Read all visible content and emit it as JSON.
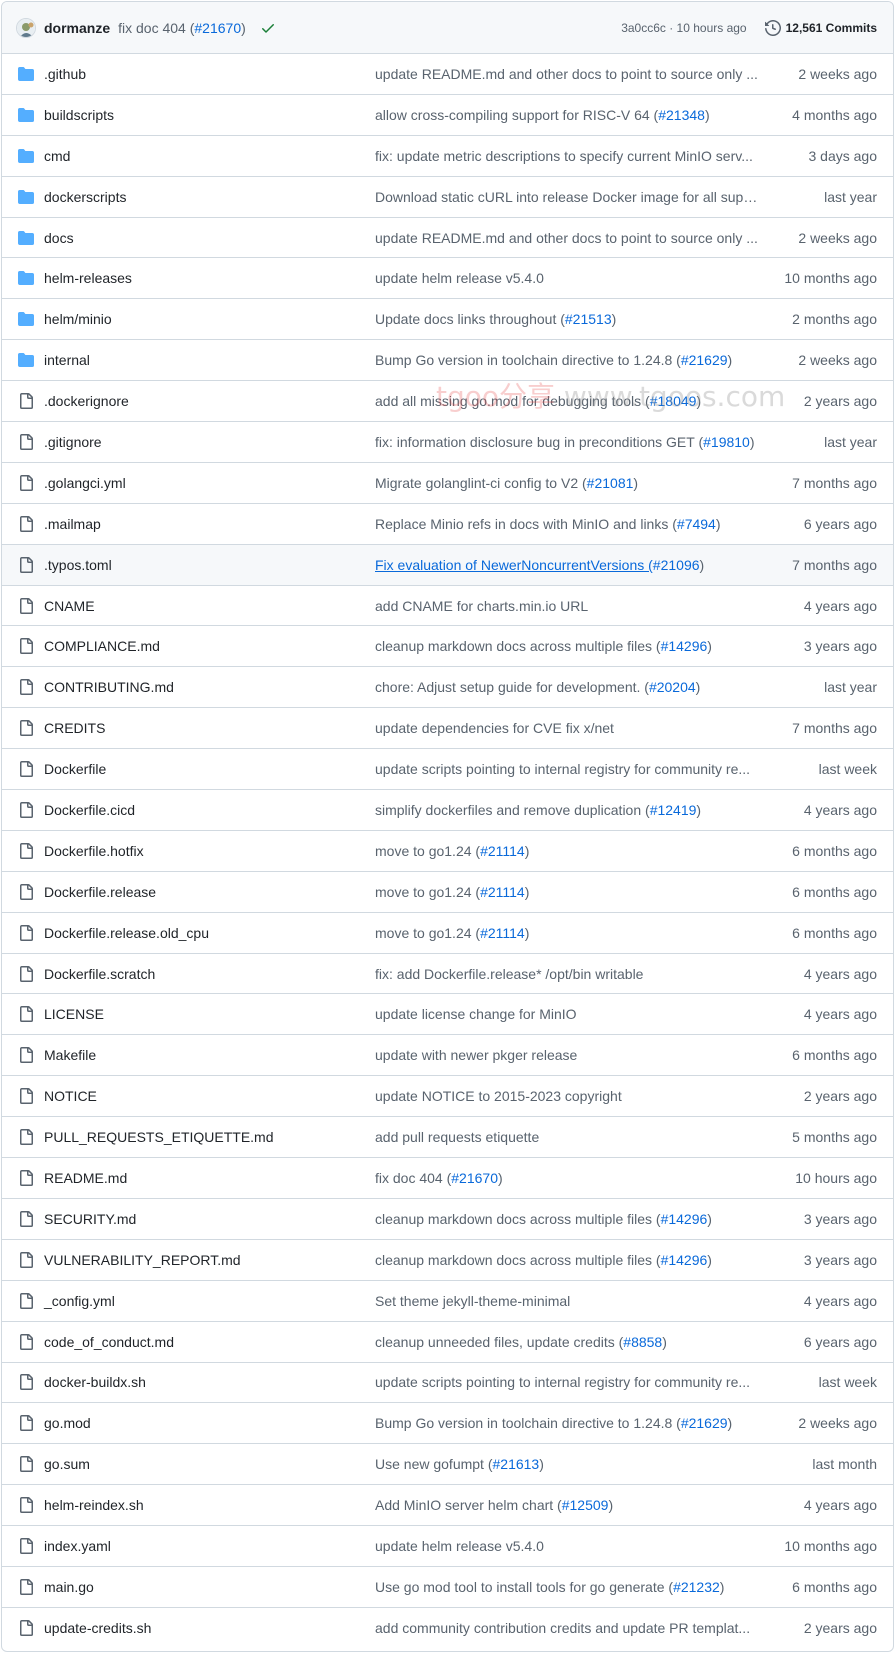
{
  "colors": {
    "folder": "#54aeff",
    "file": "#59636e",
    "link": "#0969da",
    "success": "#1a7f37",
    "border": "#d1d9e0",
    "header_bg": "#f6f8fa"
  },
  "commit": {
    "author": "dormanze",
    "message_prefix": "fix doc 404 (",
    "pr": "#21670",
    "message_suffix": ")",
    "status_icon": "check-icon",
    "sha_time": "3a0cc6c · 10 hours ago",
    "commits_count": "12,561 Commits",
    "commits_icon": "history-icon"
  },
  "watermark": {
    "brand": "tgoo分享",
    "url": "www.tgoos.com"
  },
  "files": [
    {
      "type": "dir",
      "name": ".github",
      "msg": "update README.md and other docs to point to source only ...",
      "pr": "",
      "after": "",
      "date": "2 weeks ago"
    },
    {
      "type": "dir",
      "name": "buildscripts",
      "msg": "allow cross-compiling support for RISC-V 64 (",
      "pr": "#21348",
      "after": ")",
      "date": "4 months ago"
    },
    {
      "type": "dir",
      "name": "cmd",
      "msg": "fix: update metric descriptions to specify current MinIO serv...",
      "pr": "",
      "after": "",
      "date": "3 days ago"
    },
    {
      "type": "dir",
      "name": "dockerscripts",
      "msg": "Download static cURL into release Docker image for all supp...",
      "pr": "",
      "after": "",
      "date": "last year"
    },
    {
      "type": "dir",
      "name": "docs",
      "msg": "update README.md and other docs to point to source only ...",
      "pr": "",
      "after": "",
      "date": "2 weeks ago"
    },
    {
      "type": "dir",
      "name": "helm-releases",
      "msg": "update helm release v5.4.0",
      "pr": "",
      "after": "",
      "date": "10 months ago"
    },
    {
      "type": "dir",
      "name": "helm/minio",
      "msg": "Update docs links throughout (",
      "pr": "#21513",
      "after": ")",
      "date": "2 months ago"
    },
    {
      "type": "dir",
      "name": "internal",
      "msg": "Bump Go version in toolchain directive to 1.24.8 (",
      "pr": "#21629",
      "after": ")",
      "date": "2 weeks ago"
    },
    {
      "type": "file",
      "name": ".dockerignore",
      "msg": "add all missing go.mod for debugging tools (",
      "pr": "#18049",
      "after": ")",
      "date": "2 years ago"
    },
    {
      "type": "file",
      "name": ".gitignore",
      "msg": "fix: information disclosure bug in preconditions GET (",
      "pr": "#19810",
      "after": ")",
      "date": "last year"
    },
    {
      "type": "file",
      "name": ".golangci.yml",
      "msg": "Migrate golanglint-ci config to V2 (",
      "pr": "#21081",
      "after": ")",
      "date": "7 months ago"
    },
    {
      "type": "file",
      "name": ".mailmap",
      "msg": "Replace Minio refs in docs with MinIO and links (",
      "pr": "#7494",
      "after": ")",
      "date": "6 years ago"
    },
    {
      "type": "file",
      "name": ".typos.toml",
      "msg": "Fix evaluation of NewerNoncurrentVersions (",
      "pr": "#21096",
      "after": ")",
      "date": "7 months ago",
      "hovered": true
    },
    {
      "type": "file",
      "name": "CNAME",
      "msg": "add CNAME for charts.min.io URL",
      "pr": "",
      "after": "",
      "date": "4 years ago"
    },
    {
      "type": "file",
      "name": "COMPLIANCE.md",
      "msg": "cleanup markdown docs across multiple files (",
      "pr": "#14296",
      "after": ")",
      "date": "3 years ago"
    },
    {
      "type": "file",
      "name": "CONTRIBUTING.md",
      "msg": "chore: Adjust setup guide for development. (",
      "pr": "#20204",
      "after": ")",
      "date": "last year"
    },
    {
      "type": "file",
      "name": "CREDITS",
      "msg": "update dependencies for CVE fix x/net",
      "pr": "",
      "after": "",
      "date": "7 months ago"
    },
    {
      "type": "file",
      "name": "Dockerfile",
      "msg": "update scripts pointing to internal registry for community re...",
      "pr": "",
      "after": "",
      "date": "last week"
    },
    {
      "type": "file",
      "name": "Dockerfile.cicd",
      "msg": "simplify dockerfiles and remove duplication (",
      "pr": "#12419",
      "after": ")",
      "date": "4 years ago"
    },
    {
      "type": "file",
      "name": "Dockerfile.hotfix",
      "msg": "move to go1.24 (",
      "pr": "#21114",
      "after": ")",
      "date": "6 months ago"
    },
    {
      "type": "file",
      "name": "Dockerfile.release",
      "msg": "move to go1.24 (",
      "pr": "#21114",
      "after": ")",
      "date": "6 months ago"
    },
    {
      "type": "file",
      "name": "Dockerfile.release.old_cpu",
      "msg": "move to go1.24 (",
      "pr": "#21114",
      "after": ")",
      "date": "6 months ago"
    },
    {
      "type": "file",
      "name": "Dockerfile.scratch",
      "msg": "fix: add Dockerfile.release* /opt/bin writable",
      "pr": "",
      "after": "",
      "date": "4 years ago"
    },
    {
      "type": "file",
      "name": "LICENSE",
      "msg": "update license change for MinIO",
      "pr": "",
      "after": "",
      "date": "4 years ago"
    },
    {
      "type": "file",
      "name": "Makefile",
      "msg": "update with newer pkger release",
      "pr": "",
      "after": "",
      "date": "6 months ago"
    },
    {
      "type": "file",
      "name": "NOTICE",
      "msg": "update NOTICE to 2015-2023 copyright",
      "pr": "",
      "after": "",
      "date": "2 years ago"
    },
    {
      "type": "file",
      "name": "PULL_REQUESTS_ETIQUETTE.md",
      "msg": "add pull requests etiquette",
      "pr": "",
      "after": "",
      "date": "5 months ago"
    },
    {
      "type": "file",
      "name": "README.md",
      "msg": "fix doc 404 (",
      "pr": "#21670",
      "after": ")",
      "date": "10 hours ago"
    },
    {
      "type": "file",
      "name": "SECURITY.md",
      "msg": "cleanup markdown docs across multiple files (",
      "pr": "#14296",
      "after": ")",
      "date": "3 years ago"
    },
    {
      "type": "file",
      "name": "VULNERABILITY_REPORT.md",
      "msg": "cleanup markdown docs across multiple files (",
      "pr": "#14296",
      "after": ")",
      "date": "3 years ago"
    },
    {
      "type": "file",
      "name": "_config.yml",
      "msg": "Set theme jekyll-theme-minimal",
      "pr": "",
      "after": "",
      "date": "4 years ago"
    },
    {
      "type": "file",
      "name": "code_of_conduct.md",
      "msg": "cleanup unneeded files, update credits (",
      "pr": "#8858",
      "after": ")",
      "date": "6 years ago"
    },
    {
      "type": "file",
      "name": "docker-buildx.sh",
      "msg": "update scripts pointing to internal registry for community re...",
      "pr": "",
      "after": "",
      "date": "last week"
    },
    {
      "type": "file",
      "name": "go.mod",
      "msg": "Bump Go version in toolchain directive to 1.24.8 (",
      "pr": "#21629",
      "after": ")",
      "date": "2 weeks ago"
    },
    {
      "type": "file",
      "name": "go.sum",
      "msg": "Use new gofumpt (",
      "pr": "#21613",
      "after": ")",
      "date": "last month"
    },
    {
      "type": "file",
      "name": "helm-reindex.sh",
      "msg": "Add MinIO server helm chart (",
      "pr": "#12509",
      "after": ")",
      "date": "4 years ago"
    },
    {
      "type": "file",
      "name": "index.yaml",
      "msg": "update helm release v5.4.0",
      "pr": "",
      "after": "",
      "date": "10 months ago"
    },
    {
      "type": "file",
      "name": "main.go",
      "msg": "Use go mod tool to install tools for go generate (",
      "pr": "#21232",
      "after": ")",
      "date": "6 months ago"
    },
    {
      "type": "file",
      "name": "update-credits.sh",
      "msg": "add community contribution credits and update PR templat...",
      "pr": "",
      "after": "",
      "date": "2 years ago"
    }
  ]
}
